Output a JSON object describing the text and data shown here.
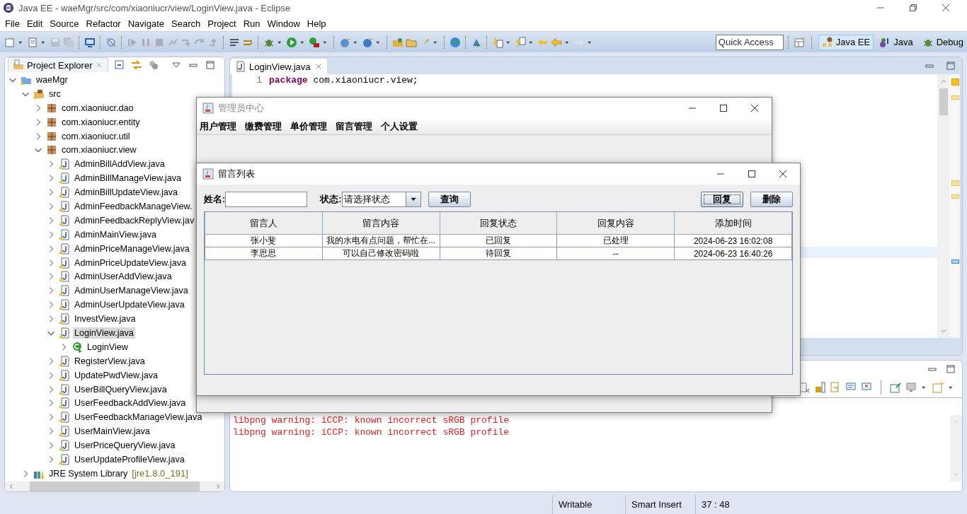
{
  "window": {
    "title": "Java EE - waeMgr/src/com/xiaoniucr/view/LoginView.java - Eclipse"
  },
  "menu": [
    "File",
    "Edit",
    "Source",
    "Refactor",
    "Navigate",
    "Search",
    "Project",
    "Run",
    "Window",
    "Help"
  ],
  "quick_access": {
    "placeholder": "Quick Access"
  },
  "perspectives": [
    {
      "label": "Java EE",
      "selected": true
    },
    {
      "label": "Java",
      "selected": false
    },
    {
      "label": "Debug",
      "selected": false
    }
  ],
  "project_explorer": {
    "title": "Project Explorer",
    "tree": [
      {
        "label": "waeMgr",
        "kind": "project",
        "expanded": true,
        "selected": false,
        "children": [
          {
            "label": "src",
            "kind": "source-folder",
            "expanded": true,
            "selected": false,
            "children": [
              {
                "label": "com.xiaoniucr.dao",
                "kind": "package",
                "expanded": false,
                "selected": false
              },
              {
                "label": "com.xiaoniucr.entity",
                "kind": "package",
                "expanded": false,
                "selected": false
              },
              {
                "label": "com.xiaoniucr.util",
                "kind": "package",
                "expanded": false,
                "selected": false
              },
              {
                "label": "com.xiaoniucr.view",
                "kind": "package",
                "expanded": true,
                "selected": false,
                "children": [
                  {
                    "label": "AdminBillAddView.java",
                    "kind": "java-file",
                    "expanded": false,
                    "selected": false
                  },
                  {
                    "label": "AdminBillManageView.java",
                    "kind": "java-file",
                    "expanded": false,
                    "selected": false
                  },
                  {
                    "label": "AdminBillUpdateView.java",
                    "kind": "java-file",
                    "expanded": false,
                    "selected": false
                  },
                  {
                    "label": "AdminFeedbackManageView.",
                    "kind": "java-file",
                    "expanded": false,
                    "selected": false
                  },
                  {
                    "label": "AdminFeedbackReplyView.jav",
                    "kind": "java-file",
                    "expanded": false,
                    "selected": false
                  },
                  {
                    "label": "AdminMainView.java",
                    "kind": "java-file",
                    "expanded": false,
                    "selected": false
                  },
                  {
                    "label": "AdminPriceManageView.java",
                    "kind": "java-file",
                    "expanded": false,
                    "selected": false
                  },
                  {
                    "label": "AdminPriceUpdateView.java",
                    "kind": "java-file",
                    "expanded": false,
                    "selected": false
                  },
                  {
                    "label": "AdminUserAddView.java",
                    "kind": "java-file",
                    "expanded": false,
                    "selected": false
                  },
                  {
                    "label": "AdminUserManageView.java",
                    "kind": "java-file",
                    "expanded": false,
                    "selected": false
                  },
                  {
                    "label": "AdminUserUpdateView.java",
                    "kind": "java-file",
                    "expanded": false,
                    "selected": false
                  },
                  {
                    "label": "InvestView.java",
                    "kind": "java-file",
                    "expanded": false,
                    "selected": false
                  },
                  {
                    "label": "LoginView.java",
                    "kind": "java-file",
                    "expanded": true,
                    "selected": true,
                    "children": [
                      {
                        "label": "LoginView",
                        "kind": "class",
                        "expanded": false,
                        "selected": false
                      }
                    ]
                  },
                  {
                    "label": "RegisterView.java",
                    "kind": "java-file",
                    "expanded": false,
                    "selected": false
                  },
                  {
                    "label": "UpdatePwdView.java",
                    "kind": "java-file",
                    "expanded": false,
                    "selected": false
                  },
                  {
                    "label": "UserBillQueryView.java",
                    "kind": "java-file",
                    "expanded": false,
                    "selected": false
                  },
                  {
                    "label": "UserFeedbackAddView.java",
                    "kind": "java-file",
                    "expanded": false,
                    "selected": false
                  },
                  {
                    "label": "UserFeedbackManageView.java",
                    "kind": "java-file",
                    "expanded": false,
                    "selected": false
                  },
                  {
                    "label": "UserMainView.java",
                    "kind": "java-file",
                    "expanded": false,
                    "selected": false
                  },
                  {
                    "label": "UserPriceQueryView.java",
                    "kind": "java-file",
                    "expanded": false,
                    "selected": false
                  },
                  {
                    "label": "UserUpdateProfileView.java",
                    "kind": "java-file",
                    "expanded": false,
                    "selected": false
                  }
                ]
              }
            ]
          },
          {
            "label": "JRE System Library",
            "suffix": "[jre1.8.0_191]",
            "kind": "library",
            "expanded": false,
            "selected": false
          }
        ]
      }
    ]
  },
  "editor": {
    "tab": "LoginView.java",
    "lines": [
      {
        "number": "1",
        "code": "**package** com.xiaoniucr.view;"
      }
    ]
  },
  "console": {
    "lines": [
      "libpng warning: iCCP: known incorrect sRGB profile",
      "libpng warning: iCCP: known incorrect sRGB profile"
    ]
  },
  "status_bar": [
    "Writable",
    "Smart Insert",
    "37 : 48"
  ],
  "admin_window": {
    "title": "管理员中心",
    "menus": [
      "用户管理",
      "缴费管理",
      "单价管理",
      "留言管理",
      "个人设置"
    ]
  },
  "feedback_window": {
    "title": "留言列表",
    "name_label": "姓名:",
    "status_label": "状态:",
    "status_value": "请选择状态",
    "query_button": "查询",
    "buttons": [
      {
        "label": "回复",
        "focused": true
      },
      {
        "label": "删除",
        "focused": false
      }
    ],
    "columns": [
      "留言人",
      "留言内容",
      "回复状态",
      "回复内容",
      "添加时间"
    ],
    "rows": [
      [
        "张小斐",
        "我的水电有点问题，帮忙在...",
        "已回复",
        "已处理",
        "2024-06-23 16:02:08"
      ],
      [
        "李思思",
        "可以自己修改密码啦",
        "待回复",
        "--",
        "2024-06-23 16:40:26"
      ]
    ]
  }
}
